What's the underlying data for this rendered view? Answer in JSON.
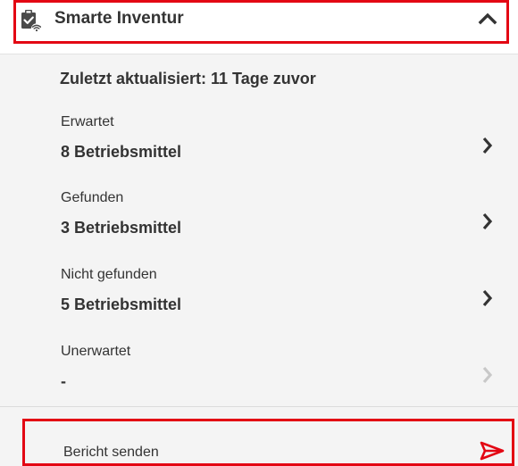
{
  "header": {
    "title": "Smarte Inventur",
    "icon": "clipboard-check-wifi-icon",
    "collapse_icon": "chevron-up-icon",
    "highlight_color": "#e30613"
  },
  "updated_text": "Zuletzt aktualisiert: 11 Tage zuvor",
  "rows": [
    {
      "label": "Erwartet",
      "value": "8 Betriebsmittel",
      "enabled": true
    },
    {
      "label": "Gefunden",
      "value": "3 Betriebsmittel",
      "enabled": true
    },
    {
      "label": "Nicht gefunden",
      "value": "5 Betriebsmittel",
      "enabled": true
    },
    {
      "label": "Unerwartet",
      "value": "-",
      "enabled": false
    }
  ],
  "send": {
    "label": "Bericht senden",
    "icon": "send-icon",
    "icon_color": "#e30613"
  }
}
